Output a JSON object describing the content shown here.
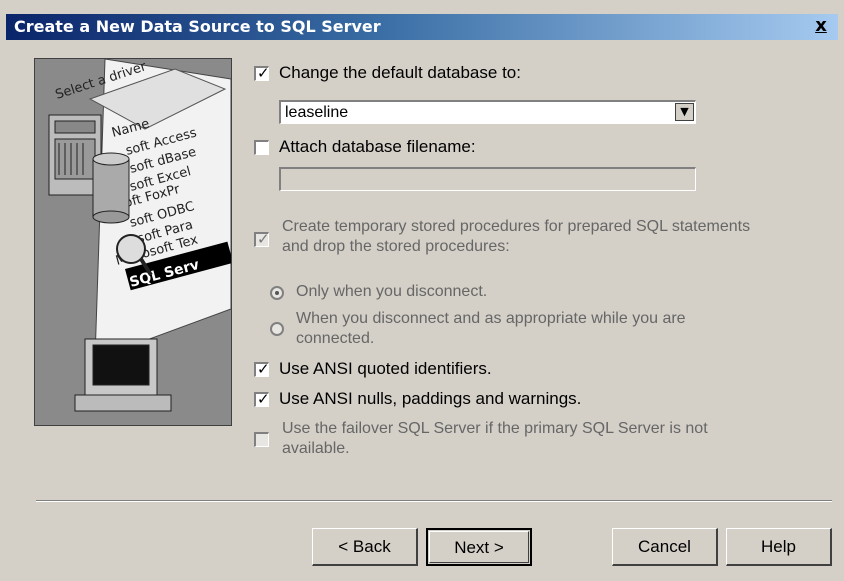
{
  "window": {
    "title": "Create a New Data Source to SQL Server",
    "close_label": "x"
  },
  "art": {
    "select_driver": "Select a driver",
    "drivers": [
      "Name",
      "soft Access",
      "soft dBase",
      "soft Excel",
      "soft FoxPr",
      "soft ODBC",
      "osoft Para",
      "Microsoft Tex",
      "SQL Serv"
    ]
  },
  "options": {
    "change_default_db": {
      "label": "Change the default database to:",
      "checked": true
    },
    "database_value": "leaseline",
    "attach_db": {
      "label": "Attach database filename:",
      "checked": false
    },
    "attach_db_value": "",
    "create_temp_procs": {
      "label_line1": "Create temporary stored procedures for prepared SQL statements",
      "label_line2": "and drop the stored procedures:",
      "checked": true
    },
    "radio_disconnect": {
      "label": "Only when you disconnect.",
      "selected": true
    },
    "radio_appropriate": {
      "label_line1": "When you disconnect and as appropriate while you are",
      "label_line2": "connected.",
      "selected": false
    },
    "ansi_quoted": {
      "label": "Use ANSI quoted identifiers.",
      "checked": true
    },
    "ansi_nulls": {
      "label": "Use ANSI nulls, paddings and warnings.",
      "checked": true
    },
    "failover": {
      "label_line1": "Use the failover SQL Server if the primary SQL Server is not",
      "label_line2": "available.",
      "checked": false
    }
  },
  "buttons": {
    "back": "< Back",
    "next": "Next >",
    "cancel": "Cancel",
    "help": "Help"
  },
  "icons": {
    "checkmark": "✓",
    "dropdown": "▼"
  }
}
